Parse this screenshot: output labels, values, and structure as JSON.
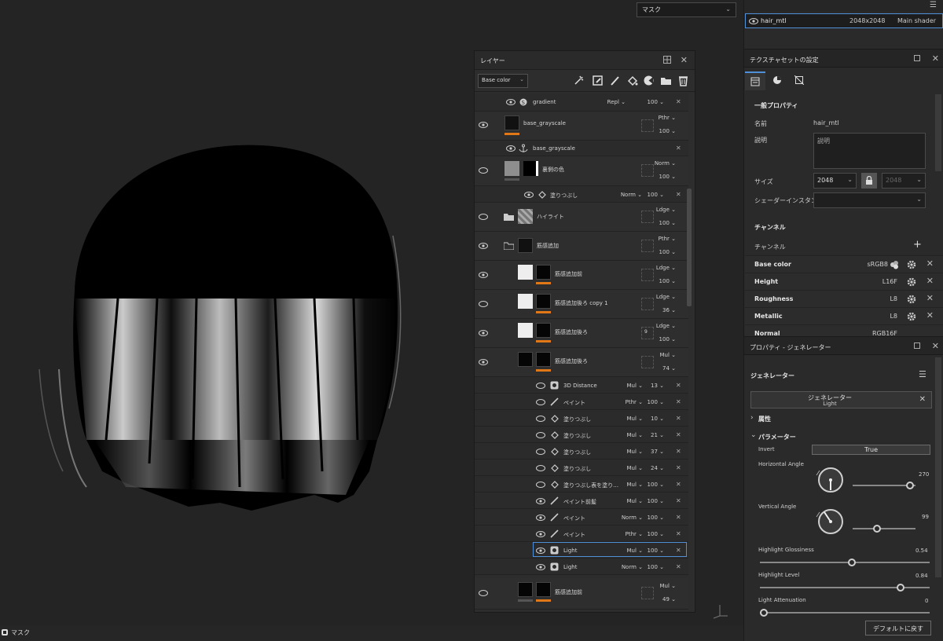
{
  "viewport": {
    "mask_dropdown": "マスク",
    "status_label": "マスク"
  },
  "layers_panel": {
    "title": "レイヤー",
    "channel_select": "Base color",
    "rows": [
      {
        "name": "gradient",
        "blend": "Repl",
        "opacity": "100"
      },
      {
        "name": "base_grayscale",
        "blend": "Pthr",
        "opacity": "100"
      },
      {
        "name": "base_grayscale"
      },
      {
        "name": "裏側の色",
        "blend": "Norm",
        "opacity": "100"
      },
      {
        "name": "塗りつぶし",
        "blend": "Norm",
        "opacity": "100"
      },
      {
        "name": "ハイライト",
        "blend": "Ldge",
        "opacity": "100"
      },
      {
        "name": "筋感追加",
        "blend": "Pthr",
        "opacity": "100"
      },
      {
        "name": "筋感追加前",
        "blend": "Ldge",
        "opacity": "100"
      },
      {
        "name": "筋感追加後ろ copy 1",
        "blend": "Ldge",
        "opacity": "36"
      },
      {
        "name": "筋感追加後ろ",
        "blend": "Ldge",
        "opacity": "100",
        "badge": "9"
      },
      {
        "name": "筋感追加後ろ",
        "blend": "Mul",
        "opacity": "74"
      },
      {
        "name": "3D Distance",
        "blend": "Mul",
        "opacity": "13"
      },
      {
        "name": "ペイント",
        "blend": "Pthr",
        "opacity": "100"
      },
      {
        "name": "塗りつぶし",
        "blend": "Mul",
        "opacity": "10"
      },
      {
        "name": "塗りつぶし",
        "blend": "Mul",
        "opacity": "21"
      },
      {
        "name": "塗りつぶし",
        "blend": "Mul",
        "opacity": "37"
      },
      {
        "name": "塗りつぶし",
        "blend": "Mul",
        "opacity": "24"
      },
      {
        "name": "塗りつぶし表を塗り…",
        "blend": "Mul",
        "opacity": "100"
      },
      {
        "name": "ペイント前髪",
        "blend": "Mul",
        "opacity": "100"
      },
      {
        "name": "ペイント",
        "blend": "Norm",
        "opacity": "100"
      },
      {
        "name": "ペイント",
        "blend": "Pthr",
        "opacity": "100"
      },
      {
        "name": "Light",
        "blend": "Mul",
        "opacity": "100"
      },
      {
        "name": "Light",
        "blend": "Norm",
        "opacity": "100"
      },
      {
        "name": "筋感追加前",
        "blend": "Mul",
        "opacity": "49"
      }
    ]
  },
  "texture_set": {
    "name": "hair_mtl",
    "size": "2048x2048",
    "shader": "Main shader"
  },
  "settings_panel": {
    "title": "テクスチャセットの設定",
    "section_general": "一般プロパティ",
    "name_label": "名前",
    "name_value": "hair_mtl",
    "desc_label": "説明",
    "desc_placeholder": "説明",
    "size_label": "サイズ",
    "size_value": "2048",
    "size_value2": "2048",
    "shader_instance_label": "シェーダーインスタンス",
    "section_channels": "チャンネル",
    "channels_label": "チャンネル",
    "channels": [
      {
        "name": "Base color",
        "format": "sRGB8"
      },
      {
        "name": "Height",
        "format": "L16F"
      },
      {
        "name": "Roughness",
        "format": "L8"
      },
      {
        "name": "Metallic",
        "format": "L8"
      },
      {
        "name": "Normal",
        "format": "RGB16F"
      }
    ]
  },
  "generator_panel": {
    "title": "プロパティ - ジェネレーター",
    "section_title": "ジェネレーター",
    "gen_button_title": "ジェネレーター",
    "gen_button_sub": "Light",
    "attr_label": "属性",
    "params_label": "パラメーター",
    "invert_label": "Invert",
    "invert_value": "True",
    "h_angle_label": "Horizontal Angle",
    "h_angle_value": "270",
    "v_angle_label": "Vertical Angle",
    "v_angle_value": "99",
    "gloss_label": "Highlight Glossiness",
    "gloss_value": "0.54",
    "level_label": "Highlight Level",
    "level_value": "0.84",
    "atten_label": "Light Attenuation",
    "atten_value": "0",
    "reset_button": "デフォルトに戻す"
  },
  "colors": {
    "accent": "#4f90d8",
    "orange": "#e07818"
  }
}
